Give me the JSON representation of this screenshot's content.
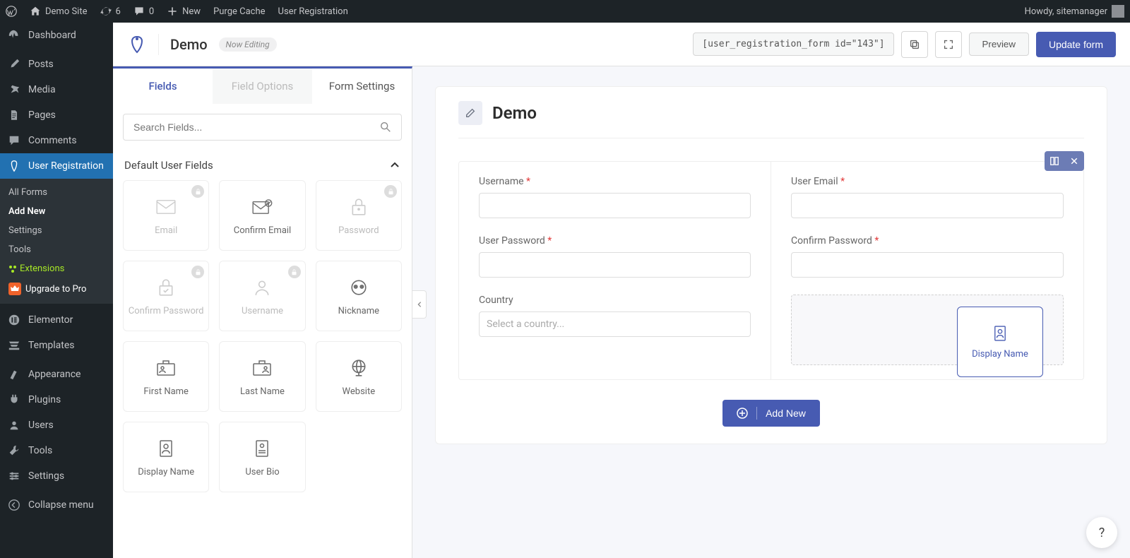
{
  "admin_bar": {
    "site_name": "Demo Site",
    "updates": "6",
    "comments": "0",
    "new": "New",
    "purge_cache": "Purge Cache",
    "user_reg": "User Registration",
    "howdy": "Howdy, sitemanager"
  },
  "sidebar": {
    "items": [
      {
        "label": "Dashboard"
      },
      {
        "label": "Posts"
      },
      {
        "label": "Media"
      },
      {
        "label": "Pages"
      },
      {
        "label": "Comments"
      },
      {
        "label": "User Registration"
      },
      {
        "label": "Elementor"
      },
      {
        "label": "Templates"
      },
      {
        "label": "Appearance"
      },
      {
        "label": "Plugins"
      },
      {
        "label": "Users"
      },
      {
        "label": "Tools"
      },
      {
        "label": "Settings"
      },
      {
        "label": "Collapse menu"
      }
    ],
    "submenu": [
      {
        "label": "All Forms"
      },
      {
        "label": "Add New"
      },
      {
        "label": "Settings"
      },
      {
        "label": "Tools"
      },
      {
        "label": "Extensions"
      },
      {
        "label": "Upgrade to Pro"
      }
    ]
  },
  "toolbar": {
    "form_name": "Demo",
    "now_editing": "Now Editing",
    "shortcode": "[user_registration_form id=\"143\"]",
    "preview": "Preview",
    "update": "Update form"
  },
  "panel": {
    "tabs": {
      "fields": "Fields",
      "options": "Field Options",
      "settings": "Form Settings"
    },
    "search_placeholder": "Search Fields...",
    "section": "Default User Fields",
    "cards": [
      {
        "label": "Email",
        "locked": true
      },
      {
        "label": "Confirm Email",
        "locked": false
      },
      {
        "label": "Password",
        "locked": true
      },
      {
        "label": "Confirm Password",
        "locked": true
      },
      {
        "label": "Username",
        "locked": true
      },
      {
        "label": "Nickname",
        "locked": false
      },
      {
        "label": "First Name",
        "locked": false
      },
      {
        "label": "Last Name",
        "locked": false
      },
      {
        "label": "Website",
        "locked": false
      },
      {
        "label": "Display Name",
        "locked": false
      },
      {
        "label": "User Bio",
        "locked": false
      }
    ]
  },
  "canvas": {
    "title": "Demo",
    "fields": {
      "username": "Username",
      "user_email": "User Email",
      "user_password": "User Password",
      "confirm_password": "Confirm Password",
      "country": "Country",
      "country_placeholder": "Select a country..."
    },
    "drag_card": "Display Name",
    "add_new": "Add New",
    "help": "?"
  }
}
